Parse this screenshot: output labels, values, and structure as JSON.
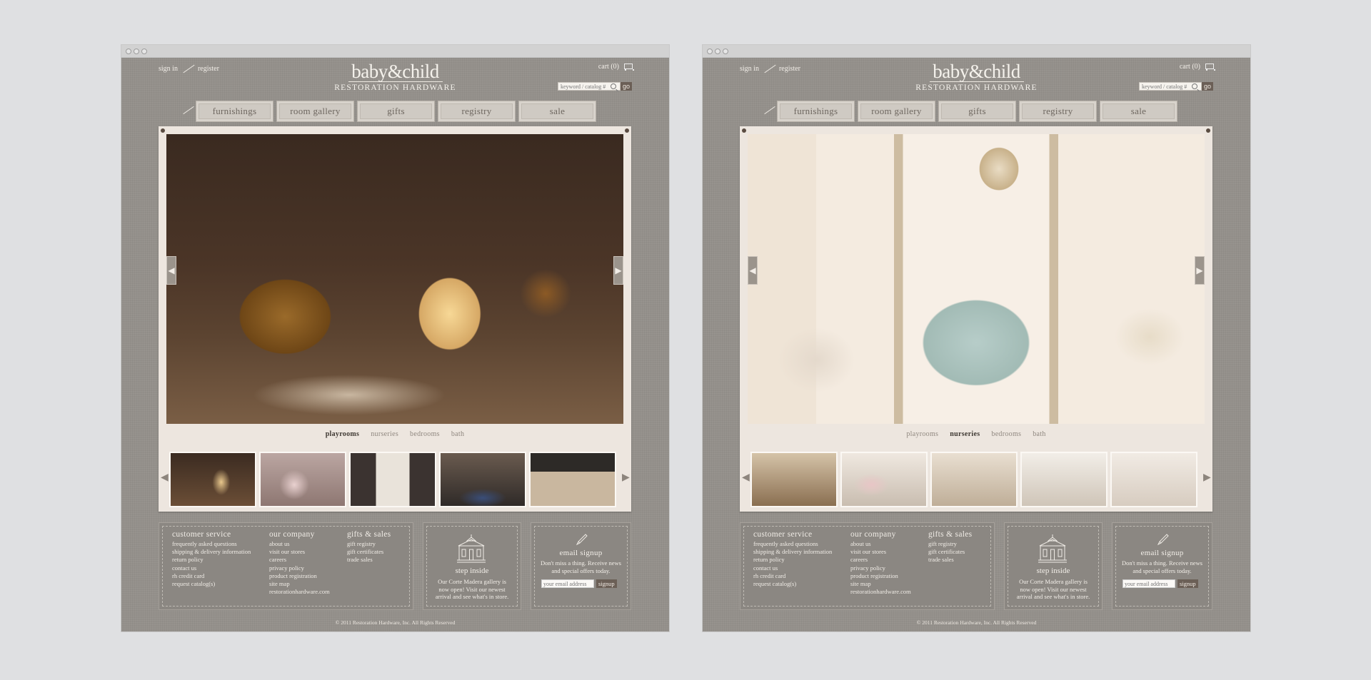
{
  "windows": [
    {
      "header": {
        "sign_in": "sign in",
        "register": "register",
        "logo_main": "baby&child",
        "logo_sub": "RESTORATION HARDWARE",
        "cart": "cart (0)"
      },
      "search": {
        "placeholder": "keyword / catalog #",
        "go": "go"
      },
      "nav": [
        {
          "label": "furnishings"
        },
        {
          "label": "room gallery"
        },
        {
          "label": "gifts"
        },
        {
          "label": "registry"
        },
        {
          "label": "sale"
        }
      ],
      "categories": [
        {
          "label": "playrooms",
          "active": true
        },
        {
          "label": "nurseries",
          "active": false
        },
        {
          "label": "bedrooms",
          "active": false
        },
        {
          "label": "bath",
          "active": false
        }
      ],
      "hero_scene": "playroom",
      "thumbnails": [
        {
          "scene": "playroom-teepee"
        },
        {
          "scene": "pink-tents"
        },
        {
          "scene": "study-room"
        },
        {
          "scene": "blue-rug-room"
        },
        {
          "scene": "dining-chalkboard"
        }
      ],
      "footer": {
        "customer_service": {
          "title": "customer service",
          "links": [
            "frequently asked questions",
            "shipping & delivery information",
            "return policy",
            "contact us",
            "rh credit card",
            "request catalog(s)"
          ]
        },
        "our_company": {
          "title": "our company",
          "links": [
            "about us",
            "visit our stores",
            "careers",
            "privacy policy",
            "product registration",
            "site map",
            "restorationhardware.com"
          ]
        },
        "gifts_sales": {
          "title": "gifts & sales",
          "links": [
            "gift registry",
            "gift certificates",
            "trade sales"
          ]
        },
        "step_inside": {
          "title": "step inside",
          "text": "Our Corte Madera gallery is now open! Visit our newest arrival and see what's in store."
        },
        "email_signup": {
          "title": "email signup",
          "text": "Don't miss a thing. Receive news and special offers today.",
          "placeholder": "your email address",
          "button": "signup"
        }
      },
      "copyright": "© 2011 Restoration Hardware, Inc. All Rights Reserved"
    },
    {
      "header": {
        "sign_in": "sign in",
        "register": "register",
        "logo_main": "baby&child",
        "logo_sub": "RESTORATION HARDWARE",
        "cart": "cart (0)"
      },
      "search": {
        "placeholder": "keyword / catalog #",
        "go": "go"
      },
      "nav": [
        {
          "label": "furnishings"
        },
        {
          "label": "room gallery"
        },
        {
          "label": "gifts"
        },
        {
          "label": "registry"
        },
        {
          "label": "sale"
        }
      ],
      "categories": [
        {
          "label": "playrooms",
          "active": false
        },
        {
          "label": "nurseries",
          "active": true
        },
        {
          "label": "bedrooms",
          "active": false
        },
        {
          "label": "bath",
          "active": false
        }
      ],
      "hero_scene": "nursery",
      "thumbnails": [
        {
          "scene": "wood-nursery"
        },
        {
          "scene": "pink-nursery"
        },
        {
          "scene": "cream-nursery"
        },
        {
          "scene": "white-nursery"
        },
        {
          "scene": "light-nursery"
        }
      ],
      "footer": {
        "customer_service": {
          "title": "customer service",
          "links": [
            "frequently asked questions",
            "shipping & delivery information",
            "return policy",
            "contact us",
            "rh credit card",
            "request catalog(s)"
          ]
        },
        "our_company": {
          "title": "our company",
          "links": [
            "about us",
            "visit our stores",
            "careers",
            "privacy policy",
            "product registration",
            "site map",
            "restorationhardware.com"
          ]
        },
        "gifts_sales": {
          "title": "gifts & sales",
          "links": [
            "gift registry",
            "gift certificates",
            "trade sales"
          ]
        },
        "step_inside": {
          "title": "step inside",
          "text": "Our Corte Madera gallery is now open! Visit our newest arrival and see what's in store."
        },
        "email_signup": {
          "title": "email signup",
          "text": "Don't miss a thing. Receive news and special offers today.",
          "placeholder": "your email address",
          "button": "signup"
        }
      },
      "copyright": "© 2011 Restoration Hardware, Inc. All Rights Reserved"
    }
  ],
  "colors": {
    "page_bg": "#dfe0e2",
    "site_bg": "#94908b",
    "panel": "#ede6df",
    "tab": "#cfcac3",
    "button": "#6b5f56"
  },
  "icons": [
    "window-dot-icon",
    "pen-icon",
    "cart-icon",
    "search-icon",
    "chevron-left-icon",
    "chevron-right-icon",
    "building-icon",
    "pencil-icon"
  ]
}
